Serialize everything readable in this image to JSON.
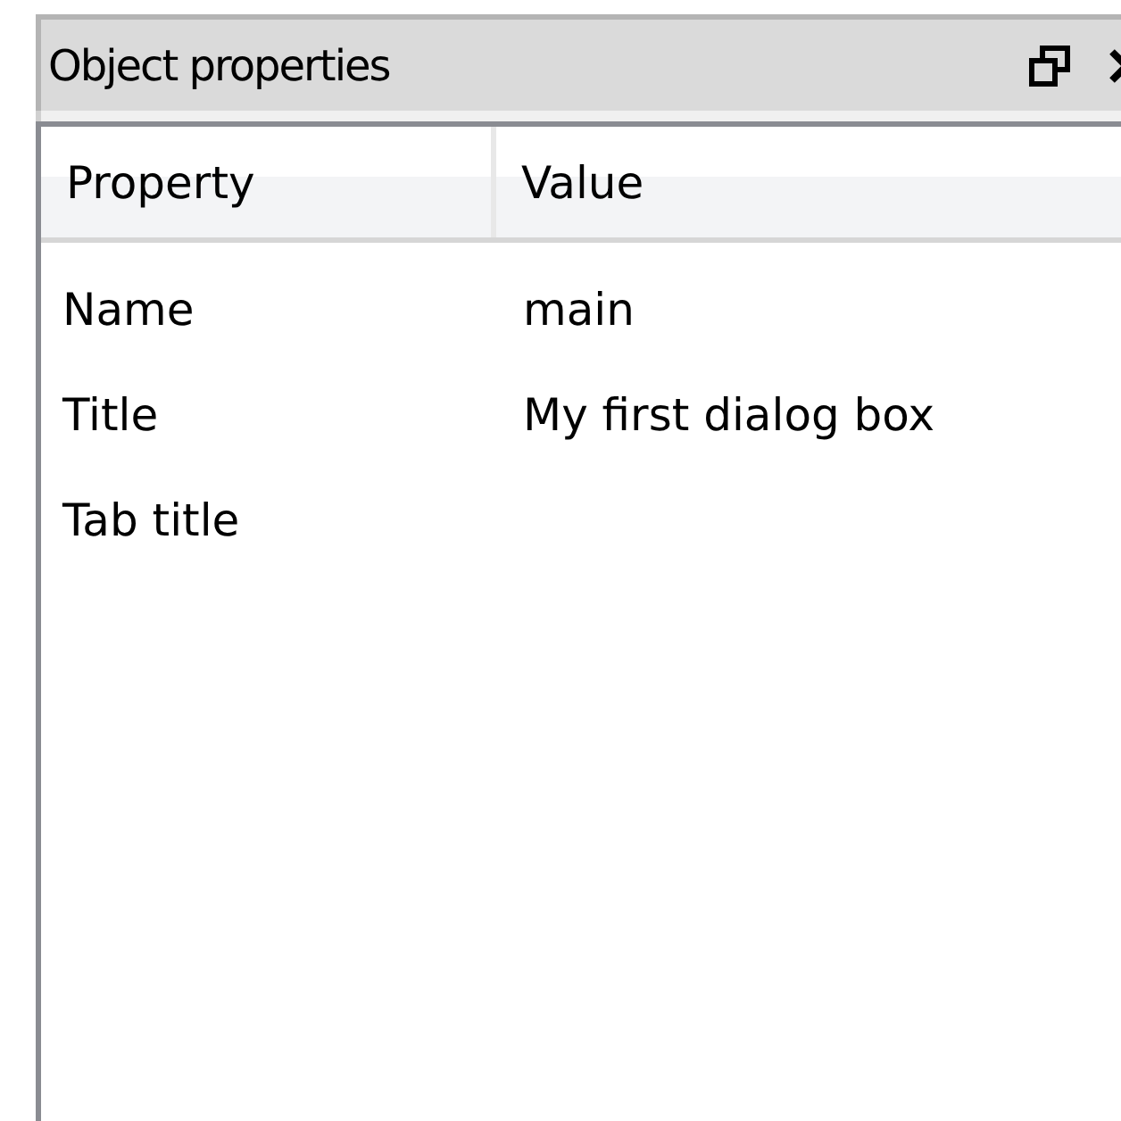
{
  "panel": {
    "title": "Object properties"
  },
  "table": {
    "columns": [
      "Property",
      "Value"
    ],
    "rows": [
      {
        "property": "Name",
        "value": "main"
      },
      {
        "property": "Title",
        "value": "My first dialog box"
      },
      {
        "property": "Tab title"
      }
    ]
  }
}
